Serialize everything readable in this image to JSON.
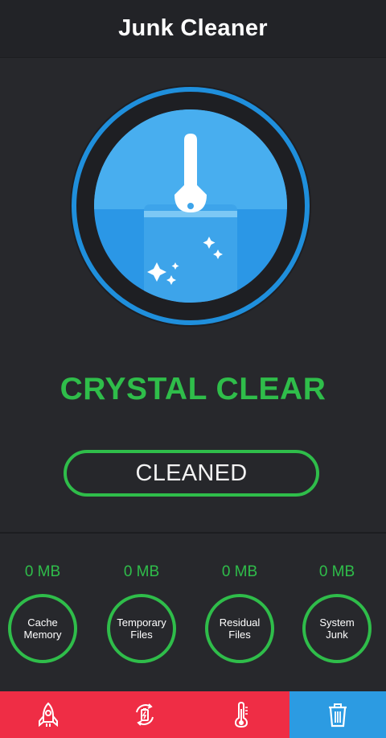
{
  "header": {
    "title": "Junk Cleaner"
  },
  "hero": {
    "icon": "broom-cleaner-icon",
    "colors": {
      "ring": "#1f8fdc",
      "fill_light": "#4fb2ef",
      "fill_dark": "#2b97e6"
    }
  },
  "status": {
    "text": "CRYSTAL CLEAR",
    "color": "#2fbd4a"
  },
  "action": {
    "label": "CLEANED"
  },
  "stats": [
    {
      "size": "0 MB",
      "label": "Cache\nMemory"
    },
    {
      "size": "0 MB",
      "label": "Temporary\nFiles"
    },
    {
      "size": "0 MB",
      "label": "Residual\nFiles"
    },
    {
      "size": "0 MB",
      "label": "System\nJunk"
    }
  ],
  "tabs": [
    {
      "icon": "rocket-icon",
      "active": false
    },
    {
      "icon": "battery-icon",
      "active": false
    },
    {
      "icon": "thermometer-icon",
      "active": false
    },
    {
      "icon": "trash-icon",
      "active": true
    }
  ],
  "colors": {
    "background": "#27282c",
    "accent_green": "#2fbd4a",
    "tab_red": "#ef2d45",
    "tab_blue": "#2c9be2"
  }
}
